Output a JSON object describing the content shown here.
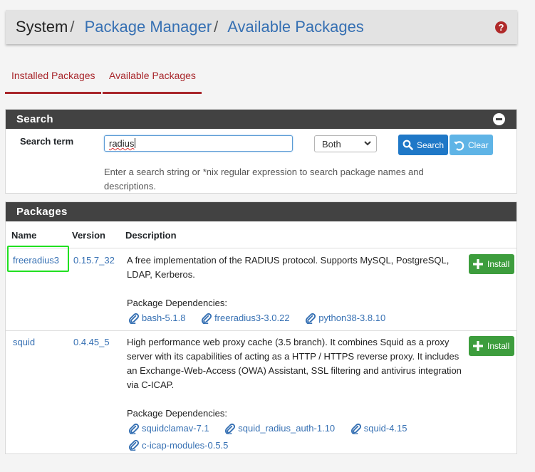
{
  "breadcrumb": {
    "system": "System",
    "sep": "/",
    "package_manager": "Package Manager",
    "available": "Available Packages"
  },
  "tabs": [
    {
      "label": "Installed Packages"
    },
    {
      "label": "Available Packages"
    }
  ],
  "search": {
    "heading": "Search",
    "term_label": "Search term",
    "term_value": "radius",
    "scope": "Both",
    "search_button": "Search",
    "clear_button": "Clear",
    "help": "Enter a search string or *nix regular expression to search package names and descriptions."
  },
  "packages": {
    "heading": "Packages",
    "columns": {
      "name": "Name",
      "version": "Version",
      "description": "Description"
    },
    "deps_label": "Package Dependencies:",
    "install_label": "Install",
    "rows": [
      {
        "name": "freeradius3",
        "version": "0.15.7_32",
        "description": "A free implementation of the RADIUS protocol. Supports MySQL, PostgreSQL, LDAP, Kerberos.",
        "dependencies": [
          "bash-5.1.8",
          "freeradius3-3.0.22",
          "python38-3.8.10"
        ]
      },
      {
        "name": "squid",
        "version": "0.4.45_5",
        "description": "High performance web proxy cache (3.5 branch). It combines Squid as a proxy server with its capabilities of acting as a HTTP / HTTPS reverse proxy. It includes an Exchange-Web-Access (OWA) Assistant, SSL filtering and antivirus integration via C-ICAP.",
        "dependencies": [
          "squidclamav-7.1",
          "squid_radius_auth-1.10",
          "squid-4.15",
          "c-icap-modules-0.5.5"
        ]
      }
    ]
  },
  "colors": {
    "header_bg": "#e3e3e3",
    "panel_heading": "#424242",
    "tab_accent": "#a8262b",
    "link": "#3670b3",
    "install_green": "#3d9d3d",
    "highlight": "#21e021"
  }
}
